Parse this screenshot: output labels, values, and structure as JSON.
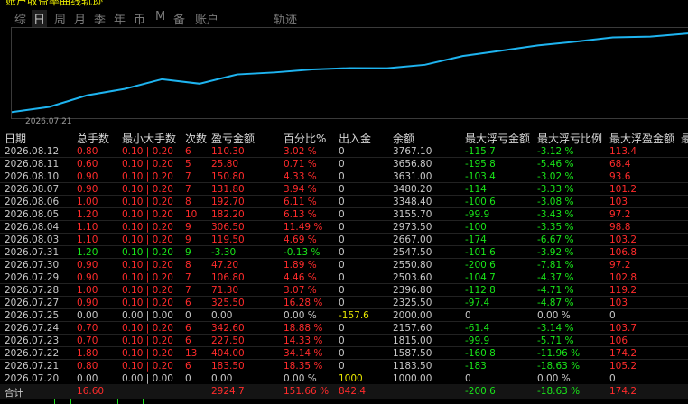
{
  "header": {
    "clipped_text": "账户收益率曲线轨迹"
  },
  "periods": [
    "综",
    "日",
    "周",
    "月",
    "季",
    "年",
    "币",
    "M",
    "备",
    "账户"
  ],
  "active_period": "日",
  "chart_title": "轨迹",
  "chart_data": {
    "type": "line",
    "title": "",
    "x": [
      "2026.07.20",
      "2026.07.21",
      "2026.07.22",
      "2026.07.23",
      "2026.07.24",
      "2026.07.25",
      "2026.07.27",
      "2026.07.28",
      "2026.07.29",
      "2026.07.30",
      "2026.07.31",
      "2026.08.03",
      "2026.08.04",
      "2026.08.05",
      "2026.08.06",
      "2026.08.07",
      "2026.08.10",
      "2026.08.11",
      "2026.08.12"
    ],
    "values": [
      1000.0,
      1183.5,
      1587.5,
      1815.0,
      2157.6,
      2000.0,
      2325.5,
      2396.8,
      2503.6,
      2550.8,
      2547.5,
      2667.0,
      2973.5,
      3155.7,
      3348.4,
      3480.2,
      3631.0,
      3656.8,
      3767.1
    ],
    "xtick_label": "2026.07.21",
    "color": "#1eb4f0",
    "grid": false
  },
  "table": {
    "columns": [
      "日期",
      "总手数",
      "最小大手数",
      "次数",
      "盈亏金额",
      "百分比%",
      "出入金",
      "余额",
      "最大浮亏金额",
      "最大浮亏比例",
      "最大浮盈金额",
      "最"
    ],
    "rows": [
      [
        "2026.08.12",
        "0.80",
        "0.10 | 0.20",
        "6",
        "110.30",
        "3.02 %",
        "0",
        "3767.10",
        "-115.7",
        "-3.12 %",
        "113.4",
        "",
        ""
      ],
      [
        "2026.08.11",
        "0.60",
        "0.10 | 0.20",
        "5",
        "25.80",
        "0.71 %",
        "0",
        "3656.80",
        "-195.8",
        "-5.46 %",
        "68.4",
        "",
        ""
      ],
      [
        "2026.08.10",
        "0.90",
        "0.10 | 0.20",
        "7",
        "150.80",
        "4.33 %",
        "0",
        "3631.00",
        "-103.4",
        "-3.02 %",
        "93.6",
        "",
        ""
      ],
      [
        "2026.08.07",
        "0.90",
        "0.10 | 0.20",
        "7",
        "131.80",
        "3.94 %",
        "0",
        "3480.20",
        "-114",
        "-3.33 %",
        "101.2",
        "",
        ""
      ],
      [
        "2026.08.06",
        "1.00",
        "0.10 | 0.20",
        "8",
        "192.70",
        "6.11 %",
        "0",
        "3348.40",
        "-100.6",
        "-3.08 %",
        "103",
        "",
        ""
      ],
      [
        "2026.08.05",
        "1.20",
        "0.10 | 0.20",
        "10",
        "182.20",
        "6.13 %",
        "0",
        "3155.70",
        "-99.9",
        "-3.43 %",
        "97.2",
        "",
        ""
      ],
      [
        "2026.08.04",
        "1.10",
        "0.10 | 0.20",
        "9",
        "306.50",
        "11.49 %",
        "0",
        "2973.50",
        "-100",
        "-3.35 %",
        "98.8",
        "",
        ""
      ],
      [
        "2026.08.03",
        "1.10",
        "0.10 | 0.20",
        "9",
        "119.50",
        "4.69 %",
        "0",
        "2667.00",
        "-174",
        "-6.67 %",
        "103.2",
        "",
        ""
      ],
      [
        "2026.07.31",
        "1.20",
        "0.10 | 0.20",
        "9",
        "-3.30",
        "-0.13 %",
        "0",
        "2547.50",
        "-101.6",
        "-3.92 %",
        "106.8",
        "",
        ""
      ],
      [
        "2026.07.30",
        "0.90",
        "0.10 | 0.20",
        "8",
        "47.20",
        "1.89 %",
        "0",
        "2550.80",
        "-200.6",
        "-7.81 %",
        "97.2",
        "",
        ""
      ],
      [
        "2026.07.29",
        "0.90",
        "0.10 | 0.20",
        "7",
        "106.80",
        "4.46 %",
        "0",
        "2503.60",
        "-104.7",
        "-4.37 %",
        "102.8",
        "",
        ""
      ],
      [
        "2026.07.28",
        "1.00",
        "0.10 | 0.20",
        "7",
        "71.30",
        "3.07 %",
        "0",
        "2396.80",
        "-112.8",
        "-4.71 %",
        "119.2",
        "",
        ""
      ],
      [
        "2026.07.27",
        "0.90",
        "0.10 | 0.20",
        "6",
        "325.50",
        "16.28 %",
        "0",
        "2325.50",
        "-97.4",
        "-4.87 %",
        "103",
        "",
        ""
      ],
      [
        "2026.07.25",
        "0.00",
        "0.00 | 0.00",
        "0",
        "0.00",
        "0.00 %",
        "-157.6",
        "2000.00",
        "0",
        "0.00 %",
        "0",
        "",
        ""
      ],
      [
        "2026.07.24",
        "0.70",
        "0.10 | 0.20",
        "6",
        "342.60",
        "18.88 %",
        "0",
        "2157.60",
        "-61.4",
        "-3.14 %",
        "103.7",
        "",
        ""
      ],
      [
        "2026.07.23",
        "0.70",
        "0.10 | 0.20",
        "6",
        "227.50",
        "14.33 %",
        "0",
        "1815.00",
        "-99.9",
        "-5.71 %",
        "106",
        "",
        ""
      ],
      [
        "2026.07.22",
        "1.80",
        "0.10 | 0.20",
        "13",
        "404.00",
        "34.14 %",
        "0",
        "1587.50",
        "-160.8",
        "-11.96 %",
        "174.2",
        "",
        ""
      ],
      [
        "2026.07.21",
        "0.80",
        "0.10 | 0.20",
        "6",
        "183.50",
        "18.35 %",
        "0",
        "1183.50",
        "-183",
        "-18.63 %",
        "105.2",
        "",
        ""
      ],
      [
        "2026.07.20",
        "0.00",
        "0.00 | 0.00",
        "0",
        "0.00",
        "0.00 %",
        "1000",
        "1000.00",
        "0",
        "0.00 %",
        "0",
        "",
        ""
      ]
    ],
    "total": [
      "合计",
      "16.60",
      "",
      "",
      "2924.7",
      "151.66 %",
      "842.4",
      "",
      "-200.6",
      "-18.63 %",
      "174.2",
      "",
      ""
    ]
  },
  "colors": {
    "profit": "#ff2b2b",
    "loss": "#19e619",
    "neutral": "#c8c8c8",
    "deposit": "#e6e600",
    "line": "#1eb4f0"
  }
}
